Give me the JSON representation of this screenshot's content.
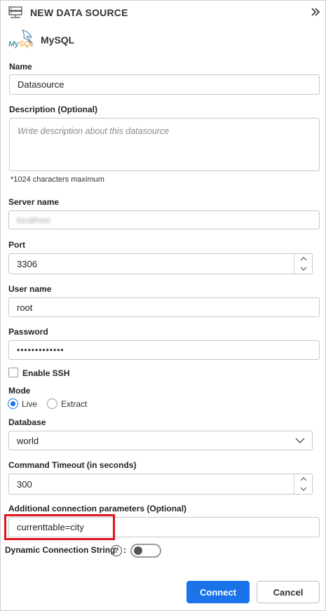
{
  "header": {
    "title": "NEW DATA SOURCE",
    "icon": "database-server-icon",
    "collapse_icon": "double-chevron-right-icon"
  },
  "connection_type": {
    "logo_text": "MySQL",
    "name": "MySQL"
  },
  "fields": {
    "name": {
      "label": "Name",
      "value": "Datasource"
    },
    "description": {
      "label": "Description (Optional)",
      "placeholder": "Write description about this datasource",
      "hint": "*1024 characters maximum"
    },
    "server_name": {
      "label": "Server name",
      "value": "localhost"
    },
    "port": {
      "label": "Port",
      "value": "3306"
    },
    "user_name": {
      "label": "User name",
      "value": "root"
    },
    "password": {
      "label": "Password",
      "value": "•••••••••••••"
    },
    "enable_ssh": {
      "label": "Enable SSH",
      "checked": false
    },
    "mode": {
      "label": "Mode",
      "options": [
        "Live",
        "Extract"
      ],
      "selected": "Live"
    },
    "database": {
      "label": "Database",
      "value": "world"
    },
    "command_timeout": {
      "label": "Command Timeout (in seconds)",
      "value": "300"
    },
    "additional_params": {
      "label": "Additional connection parameters (Optional)",
      "value": "currenttable=city"
    },
    "dynamic_connection": {
      "label": "Dynamic Connection String",
      "help": "?",
      "suffix": ":",
      "enabled": false
    }
  },
  "buttons": {
    "connect": "Connect",
    "cancel": "Cancel"
  },
  "colors": {
    "accent": "#1a73e8",
    "highlight": "#e0141e"
  }
}
